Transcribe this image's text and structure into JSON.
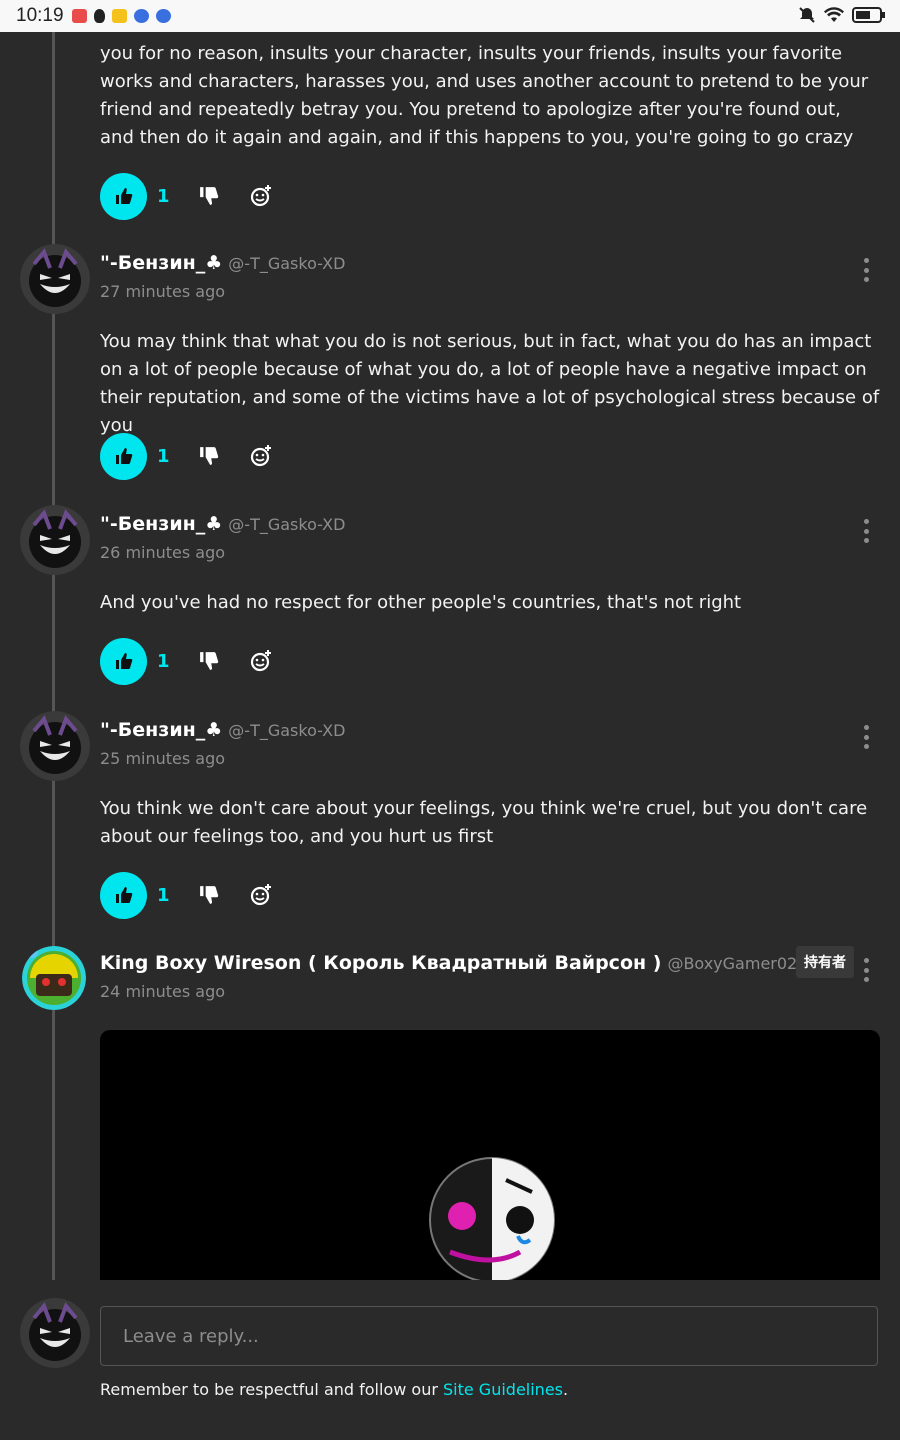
{
  "status_bar": {
    "time": "10:19"
  },
  "thread": {
    "top_comment": {
      "text": "you for no reason, insults your character, insults your friends, insults your favorite works and characters, harasses you, and uses another account to pretend to be your friend and repeatedly betray you. You pretend to apologize after you're found out, and then do it again and again, and if this happens to you, you're going to go crazy",
      "likes": "1"
    },
    "comments": [
      {
        "author": "\"-Бензин_♣",
        "handle": "@-T_Gasko-XD",
        "time": "27 minutes ago",
        "text": "You may think that what you do is not serious, but in fact, what you do has an impact on a lot of people because of what you do, a lot of people have a negative impact on their reputation, and some of the victims have a lot of psychological stress because of you",
        "likes": "1"
      },
      {
        "author": "\"-Бензин_♣",
        "handle": "@-T_Gasko-XD",
        "time": "26 minutes ago",
        "text": "And you've had no respect for other people's countries, that's not right",
        "likes": "1"
      },
      {
        "author": "\"-Бензин_♣",
        "handle": "@-T_Gasko-XD",
        "time": "25 minutes ago",
        "text": "You think we don't care about your feelings, you think we're cruel, but you don't care about our feelings too, and you hurt us first",
        "likes": "1"
      },
      {
        "author": "King Boxy Wireson ( Король Квадратный Вайрсон )",
        "handle": "@BoxyGamer02",
        "time": "24 minutes ago",
        "badge": "持有者"
      }
    ]
  },
  "composer": {
    "placeholder": "Leave a reply...",
    "guidelines_prefix": "Remember to be respectful and follow our ",
    "guidelines_link": "Site Guidelines",
    "guidelines_suffix": "."
  },
  "colors": {
    "accent": "#00e6ee",
    "background": "#2b2a2b",
    "muted": "#8d8d8d"
  },
  "icons": [
    "thumbs-up-icon",
    "thumbs-down-icon",
    "add-reaction-icon",
    "more-vertical-icon"
  ]
}
